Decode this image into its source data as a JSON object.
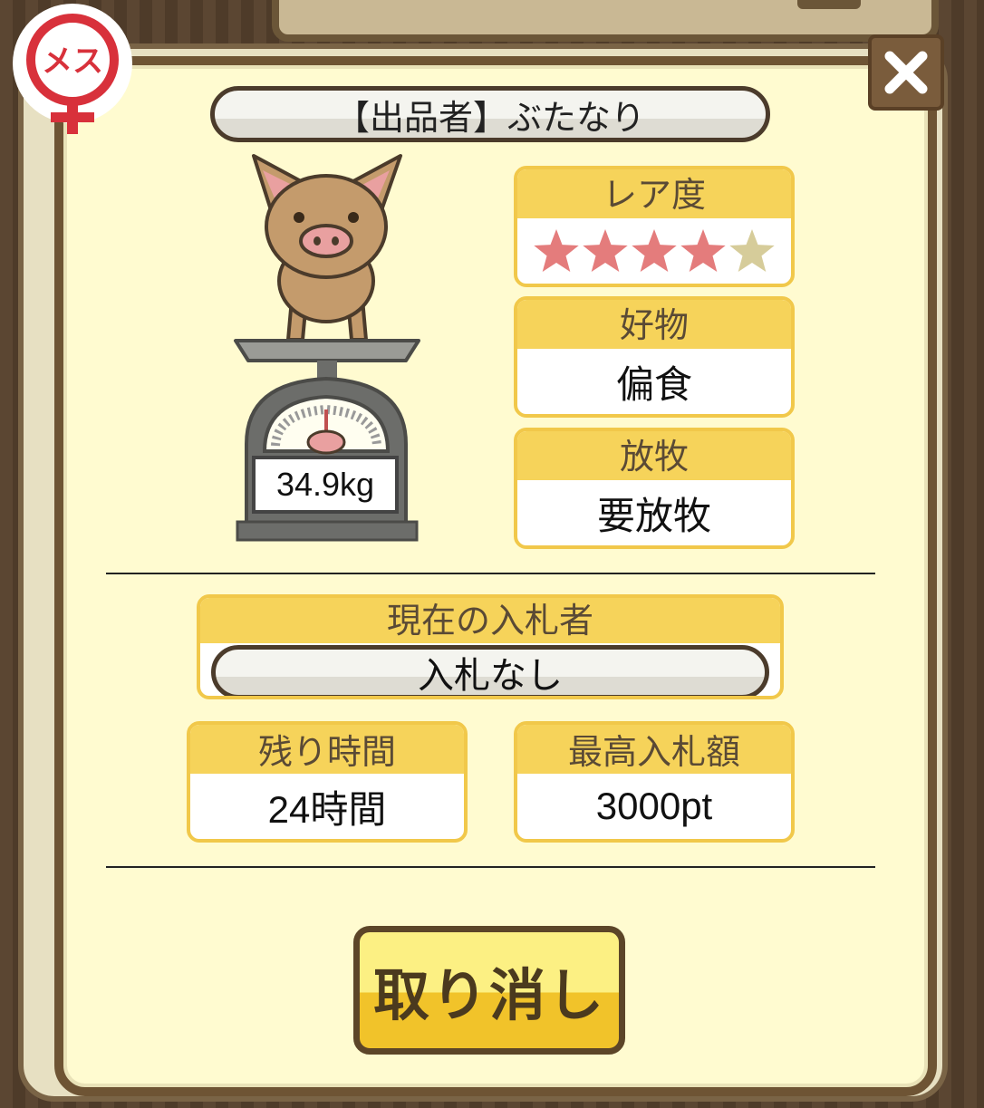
{
  "header": {
    "gender_label": "メス",
    "seller": "【出品者】ぶたなり"
  },
  "pig": {
    "weight": "34.9kg"
  },
  "stats": {
    "rarity_label": "レア度",
    "rarity_stars_filled": 4,
    "rarity_stars_total": 5,
    "favorite_label": "好物",
    "favorite_value": "偏食",
    "grazing_label": "放牧",
    "grazing_value": "要放牧"
  },
  "auction": {
    "current_bidder_label": "現在の入札者",
    "current_bidder_value": "入札なし",
    "time_left_label": "残り時間",
    "time_left_value": "24時間",
    "highest_bid_label": "最高入札額",
    "highest_bid_value": "3000pt"
  },
  "actions": {
    "cancel_label": "取り消し"
  },
  "colors": {
    "panel": "#fffbd0",
    "frame": "#6e5434",
    "card_header": "#f6d35a",
    "star_filled": "#e47c7c",
    "star_empty": "#d6cc9a",
    "gender_red": "#d8313b"
  }
}
